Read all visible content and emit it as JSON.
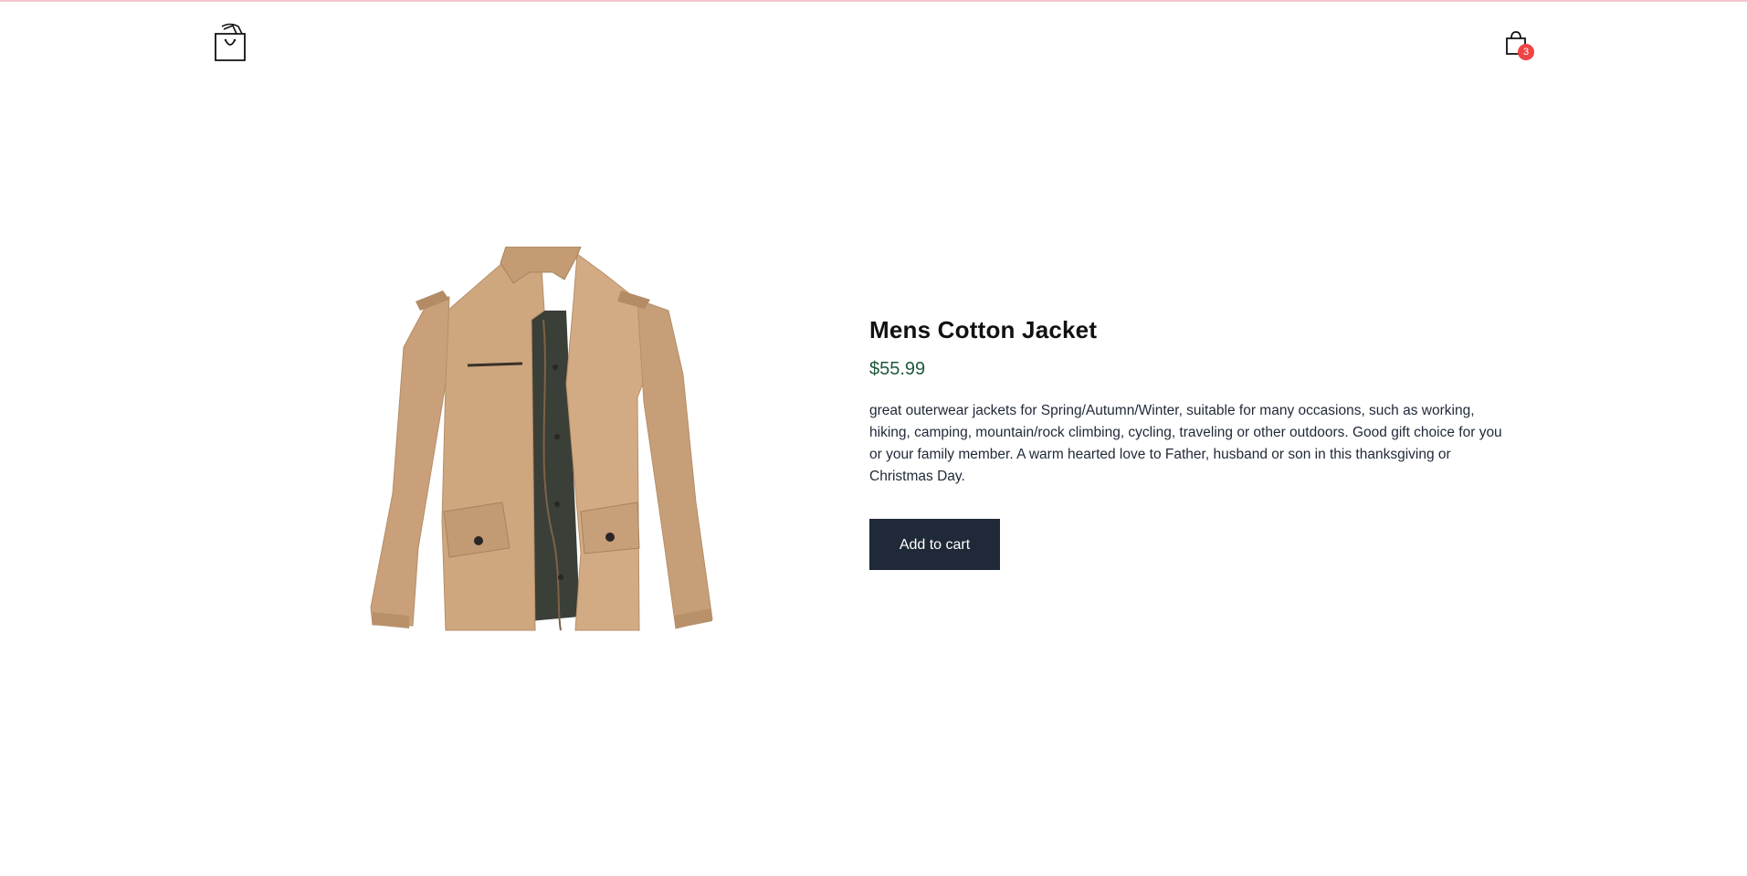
{
  "header": {
    "logo_icon": "shopping-bag-icon",
    "cart_icon": "cart-bag-icon",
    "cart_count": "3",
    "badge_color": "#ef4444"
  },
  "product": {
    "image_icon": "jacket-image",
    "title": "Mens Cotton Jacket",
    "price": "$55.99",
    "description": "great outerwear jackets for Spring/Autumn/Winter, suitable for many occasions, such as working, hiking, camping, mountain/rock climbing, cycling, traveling or other outdoors. Good gift choice for you or your family member. A warm hearted love to Father, husband or son in this thanksgiving or Christmas Day.",
    "add_to_cart_label": "Add to cart",
    "price_color": "#1f5a3a",
    "button_color": "#1f2937"
  }
}
